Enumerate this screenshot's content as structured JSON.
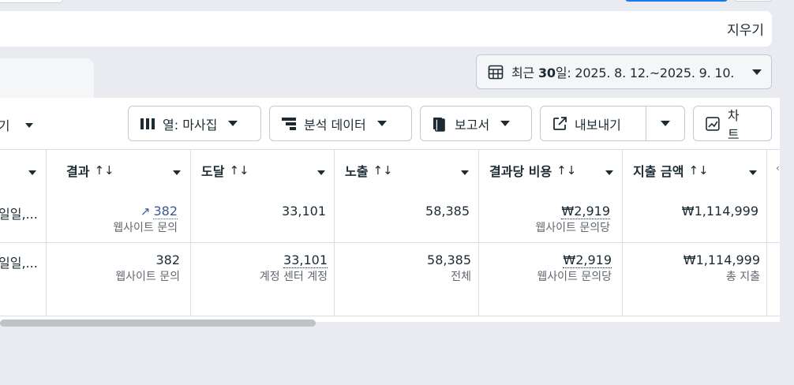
{
  "search": {
    "clear_label": "지우기"
  },
  "date_range": {
    "prefix": "최근 ",
    "days": "30",
    "suffix": "일: 2025. 8. 12.~2025. 9. 10."
  },
  "toolbar": {
    "left_partial": "보기",
    "columns_label": "열: 마사집",
    "breakdown_label": "분석 데이터",
    "reports_label": "보고서",
    "export_label": "내보내기",
    "chart_label": "차트"
  },
  "table": {
    "headers": [
      "결과",
      "도달",
      "노출",
      "결과당 비용",
      "지출 금액"
    ],
    "sort_glyph": "↑↓",
    "rows": [
      {
        "left_partial": "일일,...",
        "result": "382",
        "result_sub": "웹사이트 문의",
        "reach": "33,101",
        "impressions": "58,385",
        "cost_per_result": "₩2,919",
        "cost_sub": "웹사이트 문의당",
        "spend": "₩1,114,999"
      },
      {
        "left_partial": "일일,...",
        "result": "382",
        "result_sub": "웹사이트 문의",
        "reach": "33,101",
        "reach_sub": "계정 센터 계정",
        "impressions": "58,385",
        "impressions_sub": "전체",
        "cost_per_result": "₩2,919",
        "cost_sub": "웹사이트 문의당",
        "spend": "₩1,114,999",
        "spend_sub": "총 지출"
      }
    ]
  },
  "icons": {
    "columns": "columns-icon",
    "breakdown": "breakdown-icon",
    "reports": "reports-icon",
    "export": "export-icon",
    "chart": "chart-icon",
    "calendar": "calendar-icon",
    "trend": "trend-up-icon"
  },
  "colors": {
    "link": "#385898",
    "accent": "#1877f2"
  }
}
